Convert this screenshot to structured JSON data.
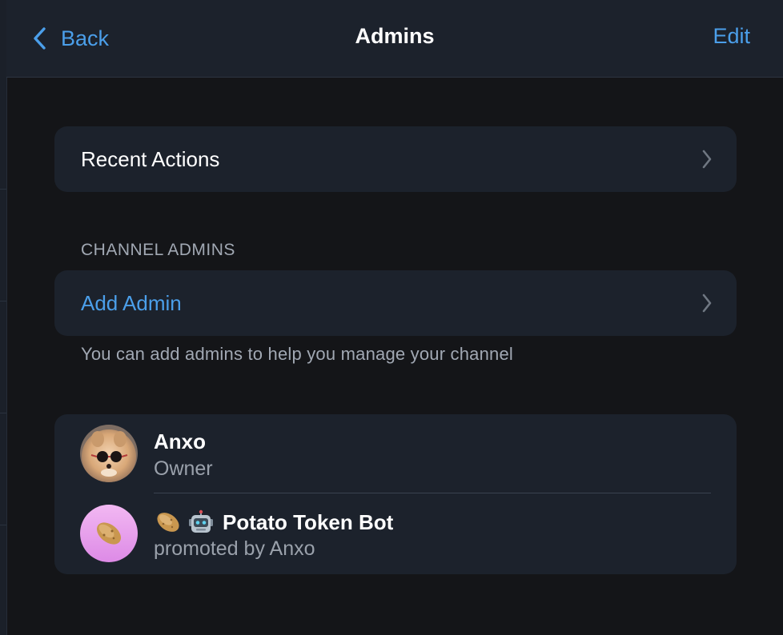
{
  "nav": {
    "back_label": "Back",
    "title": "Admins",
    "edit_label": "Edit"
  },
  "recent_actions": {
    "label": "Recent Actions"
  },
  "channel_admins": {
    "section_header": "CHANNEL ADMINS",
    "add_admin_label": "Add Admin",
    "footer_note": "You can add admins to help you manage your channel"
  },
  "admins": [
    {
      "name": "Anxo",
      "subtitle": "Owner",
      "avatar": "pomeranian-with-sunglasses-avatar"
    },
    {
      "name": "Potato Token Bot",
      "name_icons": [
        "potato-icon",
        "robot-icon"
      ],
      "subtitle": "promoted by Anxo",
      "avatar": "potato-avatar"
    }
  ],
  "colors": {
    "accent": "#4b9fea",
    "background": "#141518",
    "card": "#1c222c",
    "secondary_text": "#a1a8b3"
  }
}
